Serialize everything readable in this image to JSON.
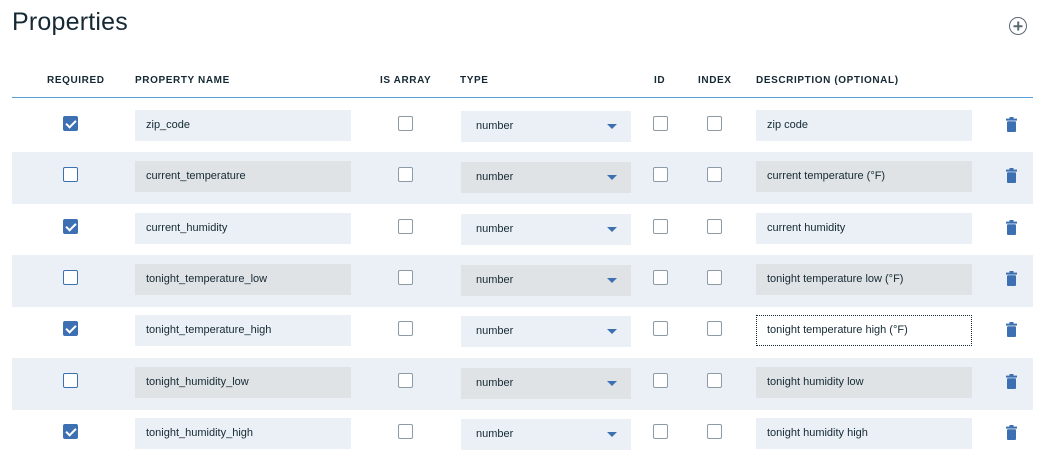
{
  "header": {
    "title": "Properties",
    "add_icon": "add-circle-icon"
  },
  "columns": {
    "required": "REQUIRED",
    "property_name": "PROPERTY NAME",
    "is_array": "IS ARRAY",
    "type": "TYPE",
    "id": "ID",
    "index": "INDEX",
    "description": "DESCRIPTION (OPTIONAL)"
  },
  "colors": {
    "accent": "#3d70b2",
    "header_rule": "#5aa0d8",
    "alt_row": "#eaf0f5"
  },
  "rows": [
    {
      "required": true,
      "name": "zip_code",
      "is_array": false,
      "type": "number",
      "id": false,
      "index": false,
      "description": "zip code"
    },
    {
      "required": true,
      "name": "current_temperature",
      "is_array": false,
      "type": "number",
      "id": false,
      "index": false,
      "description": "current temperature (°F)"
    },
    {
      "required": true,
      "name": "current_humidity",
      "is_array": false,
      "type": "number",
      "id": false,
      "index": false,
      "description": "current humidity"
    },
    {
      "required": true,
      "name": "tonight_temperature_low",
      "is_array": false,
      "type": "number",
      "id": false,
      "index": false,
      "description": "tonight temperature low (°F)"
    },
    {
      "required": true,
      "name": "tonight_temperature_high",
      "is_array": false,
      "type": "number",
      "id": false,
      "index": false,
      "description": "tonight temperature high (°F)",
      "focused": true
    },
    {
      "required": true,
      "name": "tonight_humidity_low",
      "is_array": false,
      "type": "number",
      "id": false,
      "index": false,
      "description": "tonight humidity low"
    },
    {
      "required": true,
      "name": "tonight_humidity_high",
      "is_array": false,
      "type": "number",
      "id": false,
      "index": false,
      "description": "tonight humidity high"
    }
  ]
}
